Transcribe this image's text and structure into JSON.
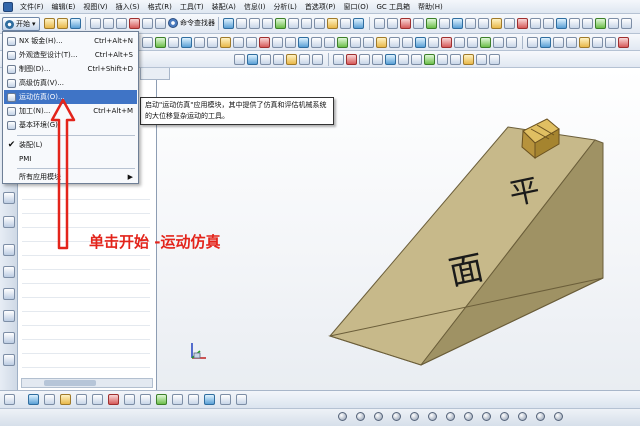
{
  "menubar": {
    "items": [
      "文件(F)",
      "编辑(E)",
      "视图(V)",
      "插入(S)",
      "格式(R)",
      "工具(T)",
      "装配(A)",
      "信息(I)",
      "分析(L)",
      "首选项(P)",
      "窗口(O)",
      "GC 工具箱",
      "帮助(H)"
    ]
  },
  "toolbar": {
    "start_label": "开始",
    "command_finder_label": "命令查找器"
  },
  "start_menu": {
    "items": [
      {
        "label": "NX 钣金(H)...",
        "shortcut": "Ctrl+Alt+N",
        "icon": "sheet-metal-icon"
      },
      {
        "label": "外观造型设计(T)...",
        "shortcut": "Ctrl+Alt+S",
        "icon": "shape-studio-icon"
      },
      {
        "label": "制图(D)...",
        "shortcut": "Ctrl+Shift+D",
        "icon": "drafting-icon"
      },
      {
        "label": "高级仿真(V)...",
        "shortcut": "",
        "icon": "advanced-simulation-icon"
      },
      {
        "label": "运动仿真(O)...",
        "shortcut": "",
        "icon": "motion-simulation-icon",
        "active": true
      },
      {
        "label": "加工(N)...",
        "shortcut": "Ctrl+Alt+M",
        "icon": "manufacturing-icon"
      },
      {
        "label": "基本环境(G)",
        "shortcut": "",
        "icon": "gateway-icon"
      },
      {
        "label": "装配(L)",
        "shortcut": "",
        "checked": true
      },
      {
        "label": "PMI",
        "shortcut": ""
      },
      {
        "label": "所有应用模块",
        "shortcut": "",
        "submenu": true
      }
    ]
  },
  "tooltip": {
    "text": "启动\"运动仿真\"应用模块，其中提供了仿真和评估机械系统的大位移复杂运动的工具。"
  },
  "annotation": {
    "text": "单击开始 -运动仿真",
    "color": "#e3241b"
  },
  "model": {
    "face_text_top": "平",
    "face_text_bottom": "面",
    "ramp_color": "#c7b98a",
    "block_color": "#c8a24a"
  },
  "colors": {
    "menu_highlight": "#3f74c6",
    "toolbar_bg": "#e1e8f2"
  }
}
